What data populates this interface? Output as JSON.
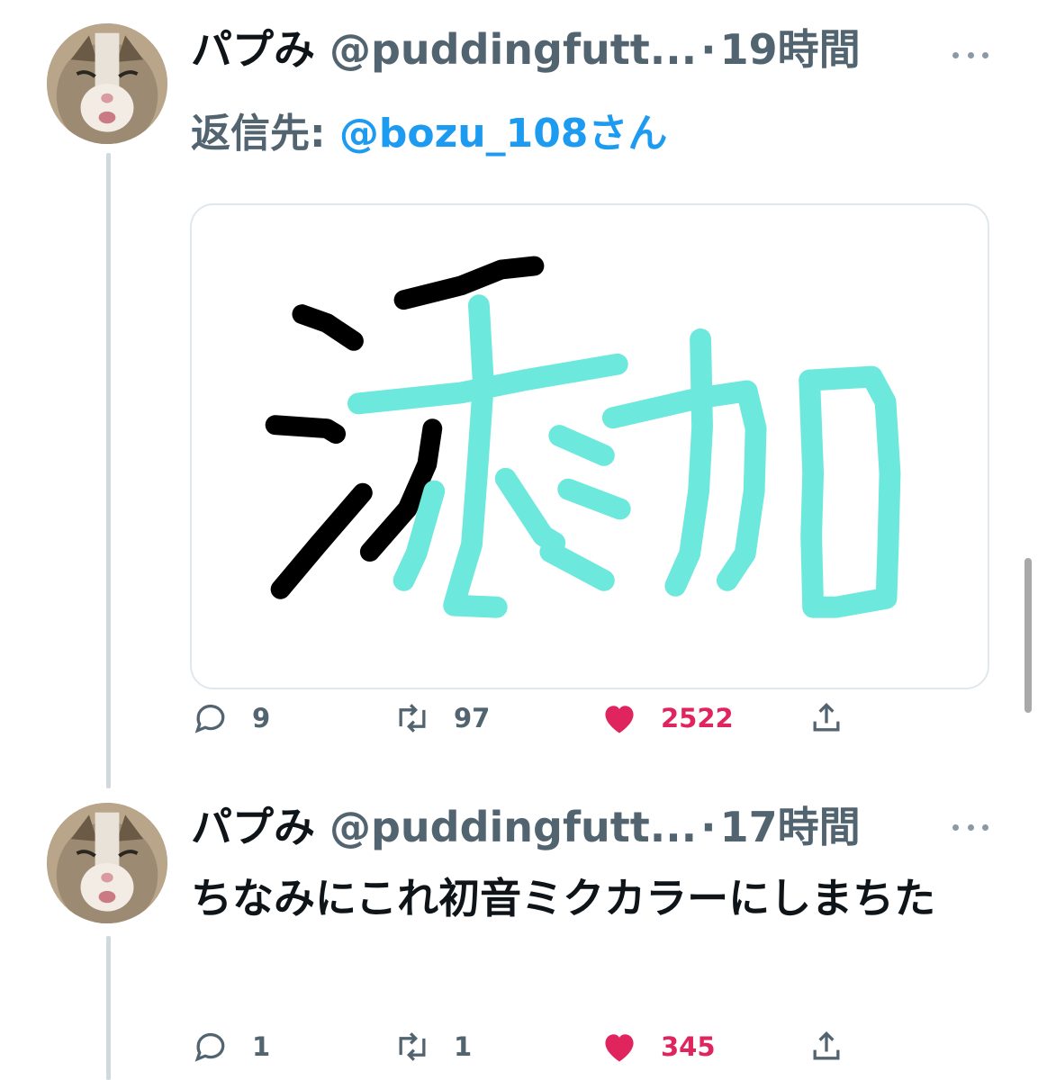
{
  "tweets": [
    {
      "name": "パプみ",
      "handle": "@puddingfutt...",
      "separator": "·",
      "time": "19時間",
      "reply_label": "返信先: ",
      "reply_mention": "@bozu_108さん",
      "media_alt_strokes": {
        "black_color": "#000000",
        "cyan_color": "#6de8dc"
      },
      "stats": {
        "replies": "9",
        "retweets": "97",
        "likes": "2522"
      }
    },
    {
      "name": "パプみ",
      "handle": "@puddingfutt...",
      "separator": "·",
      "time": "17時間",
      "text": "ちなみにこれ初音ミクカラーにしまちた",
      "stats": {
        "replies": "1",
        "retweets": "1",
        "likes": "345"
      }
    }
  ],
  "colors": {
    "like": "#e0245e",
    "mention": "#1d9bf0",
    "muted": "#536471"
  },
  "icons": [
    "reply-icon",
    "retweet-icon",
    "like-icon",
    "share-icon",
    "more-icon"
  ]
}
